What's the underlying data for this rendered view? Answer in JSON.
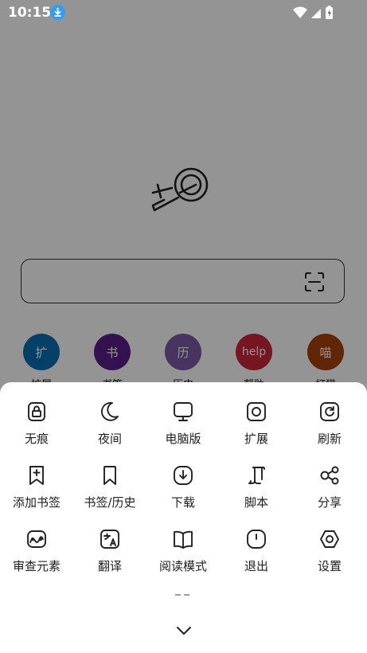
{
  "status_bar": {
    "time": "10:15"
  },
  "background": {
    "search": {
      "placeholder": ""
    },
    "shortcuts": [
      {
        "glyph": "扩",
        "label": "扩展",
        "color": "#0b6fb1"
      },
      {
        "glyph": "书",
        "label": "书签",
        "color": "#5b1f8a"
      },
      {
        "glyph": "历",
        "label": "历史",
        "color": "#7b5aa6"
      },
      {
        "glyph": "help",
        "label": "帮助",
        "color": "#c8283c"
      },
      {
        "glyph": "喵",
        "label": "打猫",
        "color": "#a8400f"
      }
    ]
  },
  "menu": {
    "items": [
      {
        "label": "无痕",
        "icon": "lock-icon"
      },
      {
        "label": "夜间",
        "icon": "moon-icon"
      },
      {
        "label": "电脑版",
        "icon": "monitor-icon"
      },
      {
        "label": "扩展",
        "icon": "extension-icon"
      },
      {
        "label": "刷新",
        "icon": "refresh-icon"
      },
      {
        "label": "添加书签",
        "icon": "bookmark-add-icon"
      },
      {
        "label": "书签/历史",
        "icon": "bookmark-icon"
      },
      {
        "label": "下载",
        "icon": "download-icon"
      },
      {
        "label": "脚本",
        "icon": "script-icon"
      },
      {
        "label": "分享",
        "icon": "share-icon"
      },
      {
        "label": "审查元素",
        "icon": "inspect-icon"
      },
      {
        "label": "翻译",
        "icon": "translate-icon"
      },
      {
        "label": "阅读模式",
        "icon": "book-icon"
      },
      {
        "label": "退出",
        "icon": "power-icon"
      },
      {
        "label": "设置",
        "icon": "settings-icon"
      }
    ]
  }
}
